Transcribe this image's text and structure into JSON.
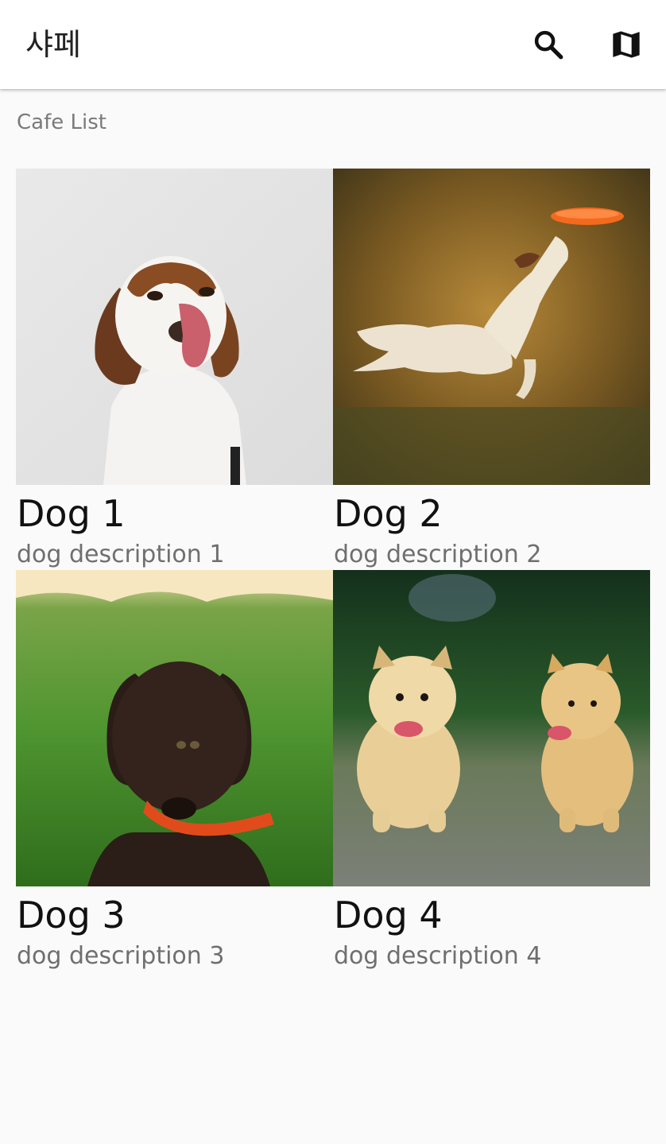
{
  "app": {
    "title": "샤페"
  },
  "actions": {
    "search_icon": "search-icon",
    "map_icon": "map-icon"
  },
  "section": {
    "label": "Cafe List"
  },
  "cards": [
    {
      "title": "Dog 1",
      "description": "dog description 1"
    },
    {
      "title": "Dog 2",
      "description": "dog description 2"
    },
    {
      "title": "Dog 3",
      "description": "dog description 3"
    },
    {
      "title": "Dog 4",
      "description": "dog description 4"
    }
  ],
  "colors": {
    "appbar_bg": "#ffffff",
    "page_bg": "#fafafa",
    "title_text": "#111111",
    "secondary_text": "#6f6f6f"
  }
}
